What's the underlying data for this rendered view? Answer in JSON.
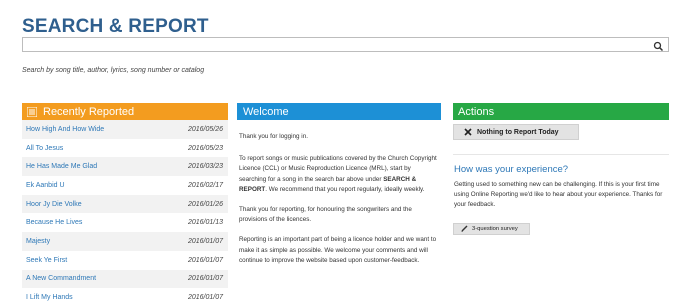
{
  "page": {
    "title": "SEARCH & REPORT"
  },
  "search": {
    "value": "",
    "placeholder": "",
    "hint": "Search by song title, author, lyrics, song number or catalog"
  },
  "recent": {
    "title": "Recently Reported",
    "items": [
      {
        "title": "How High And How Wide",
        "date": "2016/05/26"
      },
      {
        "title": "All To Jesus",
        "date": "2016/05/23"
      },
      {
        "title": "He Has Made Me Glad",
        "date": "2016/03/23"
      },
      {
        "title": "Ek Aanbid U",
        "date": "2016/02/17"
      },
      {
        "title": "Hoor Jy Die Volke",
        "date": "2016/01/26"
      },
      {
        "title": "Because He Lives",
        "date": "2016/01/13"
      },
      {
        "title": "Majesty",
        "date": "2016/01/07"
      },
      {
        "title": "Seek Ye First",
        "date": "2016/01/07"
      },
      {
        "title": "A New Commandment",
        "date": "2016/01/07"
      },
      {
        "title": "I Lift My Hands",
        "date": "2016/01/07"
      }
    ]
  },
  "welcome": {
    "title": "Welcome",
    "p1": "Thank you for logging in.",
    "p2_before": "To report songs or music publications covered by the Church Copyright Licence (CCL) or Music Reproduction Licence (MRL), start by searching for a song in the search bar above under ",
    "p2_bold": "SEARCH & REPORT",
    "p2_after": ". We recommend that you report regularly, ideally weekly.",
    "p3": "Thank you for reporting, for honouring the songwriters and the provisions of the licences.",
    "p4": "Reporting is an important part of being a licence holder and we want to make it as simple as possible. We welcome your comments and will continue to improve the website based upon customer-feedback."
  },
  "actions": {
    "title": "Actions",
    "nothing_label": "Nothing to Report Today",
    "experience_title": "How was your experience?",
    "experience_text": "Getting used to something new can be challenging. If this is your first time using Online Reporting we'd like to hear about your experience. Thanks for your feedback.",
    "survey_label": "3-question survey"
  },
  "colors": {
    "title_blue": "#2f5f8e",
    "recent_orange": "#f39c1f",
    "welcome_blue": "#1d90d6",
    "actions_green": "#27a845",
    "link_blue": "#2e78b7"
  },
  "icons": {
    "search": "search-icon",
    "list": "list-icon",
    "close": "x-icon",
    "pencil": "pencil-icon"
  }
}
